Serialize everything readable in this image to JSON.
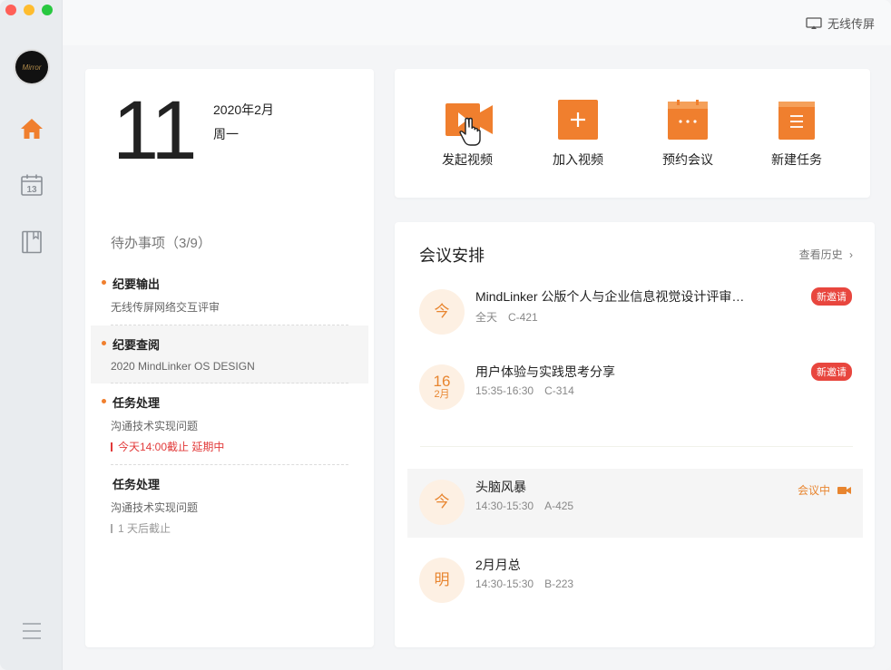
{
  "window": {
    "traffic_lights": [
      "#ff5f57",
      "#febc2e",
      "#28c840"
    ]
  },
  "sidebar": {
    "avatar_text": "Mirror",
    "items": [
      {
        "name": "home",
        "icon": "home-icon",
        "active": true
      },
      {
        "name": "calendar",
        "icon": "calendar-icon",
        "day": "13"
      },
      {
        "name": "notes",
        "icon": "notebook-icon"
      }
    ],
    "menu_icon": "hamburger-icon"
  },
  "topbar": {
    "cast_label": "无线传屏"
  },
  "today": {
    "day": "11",
    "month_year": "2020年2月",
    "weekday": "周一"
  },
  "todos": {
    "title": "待办事项（3/9）",
    "items": [
      {
        "title": "纪要输出",
        "sub": "无线传屏网络交互评审",
        "unread": true
      },
      {
        "title": "纪要查阅",
        "sub": "2020 MindLinker OS DESIGN",
        "unread": true
      },
      {
        "title": "任务处理",
        "sub": "沟通技术实现问题",
        "due": "今天14:00截止  延期中",
        "unread": true
      },
      {
        "title": "任务处理",
        "sub": "沟通技术实现问题",
        "due": "1 天后截止",
        "unread": false
      }
    ]
  },
  "actions": [
    {
      "label": "发起视频",
      "icon": "video-camera-icon"
    },
    {
      "label": "加入视频",
      "icon": "plus-icon"
    },
    {
      "label": "预约会议",
      "icon": "calendar-dots-icon"
    },
    {
      "label": "新建任务",
      "icon": "task-list-icon"
    }
  ],
  "meetings": {
    "title": "会议安排",
    "history_label": "查看历史",
    "items": [
      {
        "badge": "今",
        "name": "MindLinker 公版个人与企业信息视觉设计评审…",
        "time": "全天",
        "room": "C-421",
        "tag": "新邀请"
      },
      {
        "badge": "16",
        "badge_sub": "2月",
        "name": "用户体验与实践思考分享",
        "time": "15:35-16:30",
        "room": "C-314",
        "tag": "新邀请"
      },
      {
        "badge": "今",
        "name": "头脑风暴",
        "time": "14:30-15:30",
        "room": "A-425",
        "status": "会议中"
      },
      {
        "badge": "明",
        "name": "2月月总",
        "time": "14:30-15:30",
        "room": "B-223"
      }
    ]
  },
  "colors": {
    "accent": "#f07f2e",
    "badge_bg": "#fdf0e3",
    "tag_red": "#e8463e"
  }
}
